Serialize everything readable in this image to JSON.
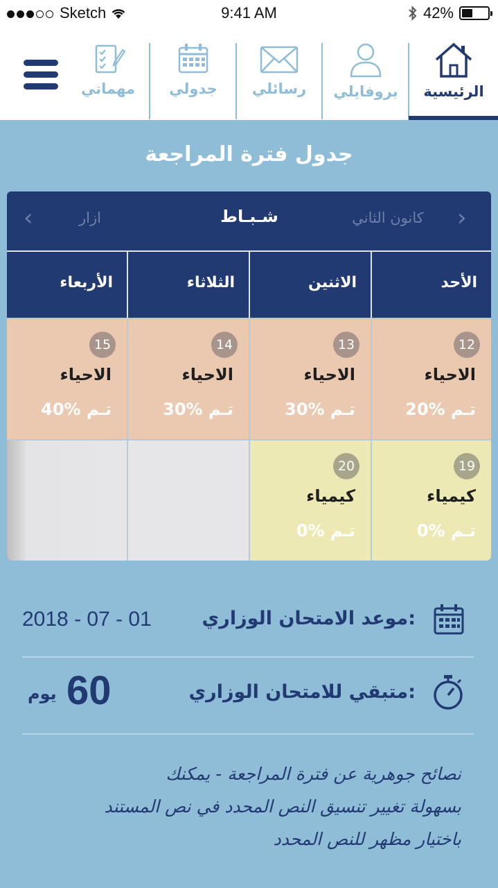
{
  "status_bar": {
    "carrier": "Sketch",
    "time": "9:41 AM",
    "battery": "42%",
    "battery_level": 0.42
  },
  "nav": {
    "tabs": [
      {
        "label": "الرئيسية",
        "icon": "home-icon",
        "active": true
      },
      {
        "label": "بروفايلي",
        "icon": "profile-icon",
        "active": false
      },
      {
        "label": "رسائلي",
        "icon": "envelope-icon",
        "active": false
      },
      {
        "label": "جدولي",
        "icon": "calendar-icon",
        "active": false
      },
      {
        "label": "مهماتي",
        "icon": "tasks-icon",
        "active": false
      }
    ],
    "menu_icon": "hamburger-menu-icon",
    "accent": "#223a72",
    "muted": "#8fbdd8"
  },
  "page": {
    "title": "جدول فترة المراجعة"
  },
  "calendar": {
    "prev_month": "كانون الثاني",
    "current_month": "شـبـاط",
    "next_month": "ازار",
    "days": [
      "الأحد",
      "الاثنين",
      "الثلاثاء",
      "الأربعاء"
    ],
    "week1": [
      {
        "num": "12",
        "subject": "الاحياء",
        "progress": "20% تـم"
      },
      {
        "num": "13",
        "subject": "الاحياء",
        "progress": "30% تـم"
      },
      {
        "num": "14",
        "subject": "الاحياء",
        "progress": "30% تـم"
      },
      {
        "num": "15",
        "subject": "الاحياء",
        "progress": "40% تـم"
      }
    ],
    "week2": [
      {
        "num": "19",
        "subject": "كيمياء",
        "progress": "0% تـم"
      },
      {
        "num": "20",
        "subject": "كيمياء",
        "progress": "0% تـم"
      }
    ],
    "colors": {
      "peach": "#ebc9b0",
      "yellow": "#ede9b5",
      "header": "#223a72"
    }
  },
  "exam": {
    "date_label": "موعد الامتحان الوزاري:",
    "date_value": "2018 - 07 - 01",
    "remaining_label": "متبقي للامتحان الوزاري:",
    "remaining_value": "60",
    "remaining_unit": "يوم"
  },
  "tips": {
    "line1": "نصائح جوهرية عن فترة المراجعة - يمكنك",
    "line2": "بسهولة تغيير تنسيق النص المحدد في نص المستند",
    "line3": "باختيار مظهر للنص المحدد"
  }
}
